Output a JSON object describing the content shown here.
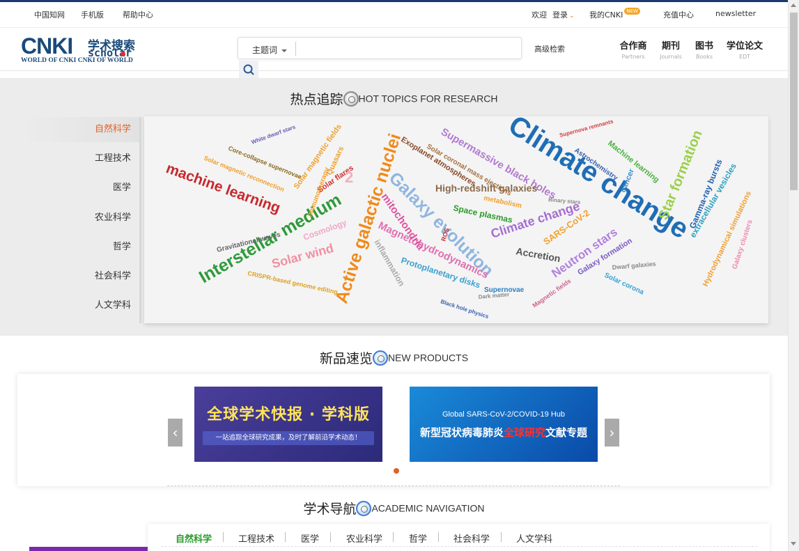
{
  "topbar": {
    "links": [
      "中国知网",
      "手机版",
      "帮助中心"
    ],
    "welcome": "欢迎",
    "login": "登录",
    "my_cnki": "我的CNKI",
    "new_badge": "NEW",
    "recharge": "充值中心",
    "newsletter": "newsletter"
  },
  "logo": {
    "main": "CNKI",
    "cn": "学术搜索",
    "scholar": "scholar",
    "subtitle": "WORLD OF CNKI CNKI OF WORLD"
  },
  "search": {
    "field_select": "主题词",
    "placeholder": "",
    "advanced": "高级检索"
  },
  "nav": [
    {
      "cn": "合作商",
      "en": "Partners"
    },
    {
      "cn": "期刊",
      "en": "Journals"
    },
    {
      "cn": "图书",
      "en": "Books"
    },
    {
      "cn": "学位论文",
      "en": "EDT"
    }
  ],
  "hot_topics": {
    "title_cn": "热点追踪",
    "title_en": "HOT TOPICS FOR RESEARCH",
    "categories": [
      "自然科学",
      "工程技术",
      "医学",
      "农业科学",
      "哲学",
      "社会科学",
      "人文学科"
    ],
    "active_category": "自然科学",
    "cloud_words": [
      "Climate change",
      "Interstellar medium",
      "Active galactic nuclei",
      "machine learning",
      "Galaxy evolution",
      "Star formation",
      "Solar wind",
      "Magnetohydrodynamics",
      "Supermassive black holes",
      "High-redshift galaxies",
      "Climate change",
      "mitochondria",
      "Neutron stars",
      "Space plasmas",
      "Accretion",
      "SARS-CoV-2",
      "Gamma-ray bursts",
      "extracellular vesicles",
      "Hydrodynamical simulations",
      "Protoplanetary disks",
      "Cosmology",
      "Gravitational waves",
      "Galaxy formation",
      "Exoplanet atmospheres",
      "Solar coronal mass ejections",
      "Machine learning",
      "Solar magnetic fields",
      "Solar flares",
      "Quasars",
      "Astrochemistry",
      "Supernovae",
      "inflammation",
      "Magnetic fields",
      "cancer",
      "Solar corona",
      "Galaxy clusters",
      "Dwarf galaxies",
      "Solar magnetic reconnection",
      "Core-collapse supernovae",
      "CRISPR-based genome editing",
      "metabolism",
      "Binary stars",
      "White dwarf stars",
      "Supernova remnants",
      "immunotherapy",
      "Black hole physics",
      "Dark matter",
      "ROS",
      "2"
    ]
  },
  "new_products": {
    "title_cn": "新品速览",
    "title_en": "NEW PRODUCTS",
    "banner1_title": "全球学术快报 · 学科版",
    "banner1_sub": "一站追踪全球研究成果，及时了解前沿学术动态！",
    "banner2_line1": "Global SARS-CoV-2/COVID-19 Hub",
    "banner2_line2_a": "新型冠状病毒肺炎",
    "banner2_line2_hl": "全球研究",
    "banner2_line2_b": "文献专题",
    "prev": "‹",
    "next": "›"
  },
  "academic_nav": {
    "title_cn": "学术导航",
    "title_en": "ACADEMIC NAVIGATION",
    "tabs": [
      "自然科学",
      "工程技术",
      "医学",
      "农业科学",
      "哲学",
      "社会科学",
      "人文学科"
    ],
    "active_tab": "自然科学"
  },
  "colors": {
    "brand": "#1a4a7a",
    "active_orange": "#e0602a",
    "active_green": "#2a9a2a"
  }
}
